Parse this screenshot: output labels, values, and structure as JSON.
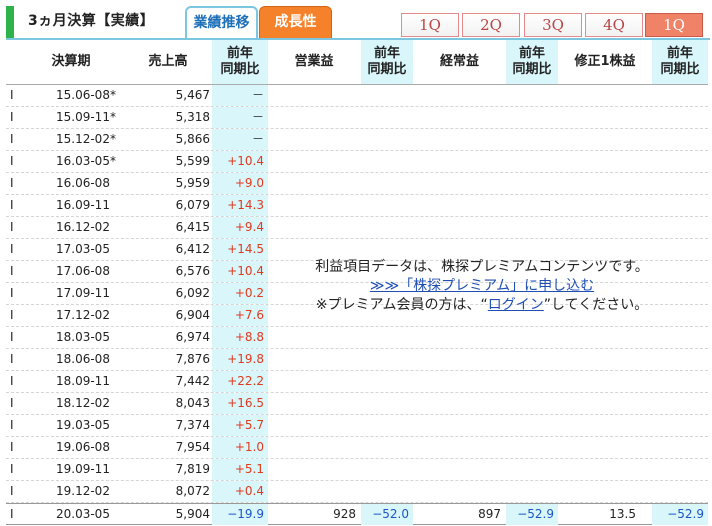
{
  "header": {
    "title": "3ヵ月決算【実績】",
    "tab_perf": "業績推移",
    "tab_growth": "成長性",
    "quarter_tabs": [
      "1Q",
      "2Q",
      "3Q",
      "4Q",
      "1Q"
    ],
    "active_quarter_index": 4,
    "colors": {
      "accent": "#2fb24a",
      "growth_tab": "#f5822a",
      "perf_tab_text": "#1d6fb8",
      "cyan_column": "#d9f6fb",
      "positive": "#e03a1e",
      "negative": "#1c55c7"
    }
  },
  "columns": {
    "period": "決算期",
    "sales": "売上高",
    "yoy": "前年\n同期比",
    "op": "営業益",
    "ordinary": "経常益",
    "eps": "修正1株益"
  },
  "rows": [
    {
      "mark": "I",
      "period": "15.06-08*",
      "sales": "5,467",
      "yoy": "－",
      "dir": "flat"
    },
    {
      "mark": "I",
      "period": "15.09-11*",
      "sales": "5,318",
      "yoy": "－",
      "dir": "flat"
    },
    {
      "mark": "I",
      "period": "15.12-02*",
      "sales": "5,866",
      "yoy": "－",
      "dir": "flat"
    },
    {
      "mark": "I",
      "period": "16.03-05*",
      "sales": "5,599",
      "yoy": "+10.4",
      "dir": "pos"
    },
    {
      "mark": "I",
      "period": "16.06-08",
      "sales": "5,959",
      "yoy": "+9.0",
      "dir": "pos"
    },
    {
      "mark": "I",
      "period": "16.09-11",
      "sales": "6,079",
      "yoy": "+14.3",
      "dir": "pos"
    },
    {
      "mark": "I",
      "period": "16.12-02",
      "sales": "6,415",
      "yoy": "+9.4",
      "dir": "pos"
    },
    {
      "mark": "I",
      "period": "17.03-05",
      "sales": "6,412",
      "yoy": "+14.5",
      "dir": "pos"
    },
    {
      "mark": "I",
      "period": "17.06-08",
      "sales": "6,576",
      "yoy": "+10.4",
      "dir": "pos"
    },
    {
      "mark": "I",
      "period": "17.09-11",
      "sales": "6,092",
      "yoy": "+0.2",
      "dir": "pos"
    },
    {
      "mark": "I",
      "period": "17.12-02",
      "sales": "6,904",
      "yoy": "+7.6",
      "dir": "pos"
    },
    {
      "mark": "I",
      "period": "18.03-05",
      "sales": "6,974",
      "yoy": "+8.8",
      "dir": "pos"
    },
    {
      "mark": "I",
      "period": "18.06-08",
      "sales": "7,876",
      "yoy": "+19.8",
      "dir": "pos"
    },
    {
      "mark": "I",
      "period": "18.09-11",
      "sales": "7,442",
      "yoy": "+22.2",
      "dir": "pos"
    },
    {
      "mark": "I",
      "period": "18.12-02",
      "sales": "8,043",
      "yoy": "+16.5",
      "dir": "pos"
    },
    {
      "mark": "I",
      "period": "19.03-05",
      "sales": "7,374",
      "yoy": "+5.7",
      "dir": "pos"
    },
    {
      "mark": "I",
      "period": "19.06-08",
      "sales": "7,954",
      "yoy": "+1.0",
      "dir": "pos"
    },
    {
      "mark": "I",
      "period": "19.09-11",
      "sales": "7,819",
      "yoy": "+5.1",
      "dir": "pos"
    },
    {
      "mark": "I",
      "period": "19.12-02",
      "sales": "8,072",
      "yoy": "+0.4",
      "dir": "pos"
    }
  ],
  "last_row": {
    "mark": "I",
    "period": "20.03-05",
    "sales": "5,904",
    "sales_yoy": "−19.9",
    "op": "928",
    "op_yoy": "−52.0",
    "ordinary": "897",
    "ordinary_yoy": "−52.9",
    "eps": "13.5",
    "eps_yoy": "−52.9"
  },
  "notice": {
    "line1": "利益項目データは、株探プレミアムコンテンツです。",
    "link_signup": "≫≫「株探プレミアム」に申し込む",
    "line3_prefix": "※プレミアム会員の方は、“",
    "link_login": "ログイン",
    "line3_suffix": "”してください。"
  }
}
